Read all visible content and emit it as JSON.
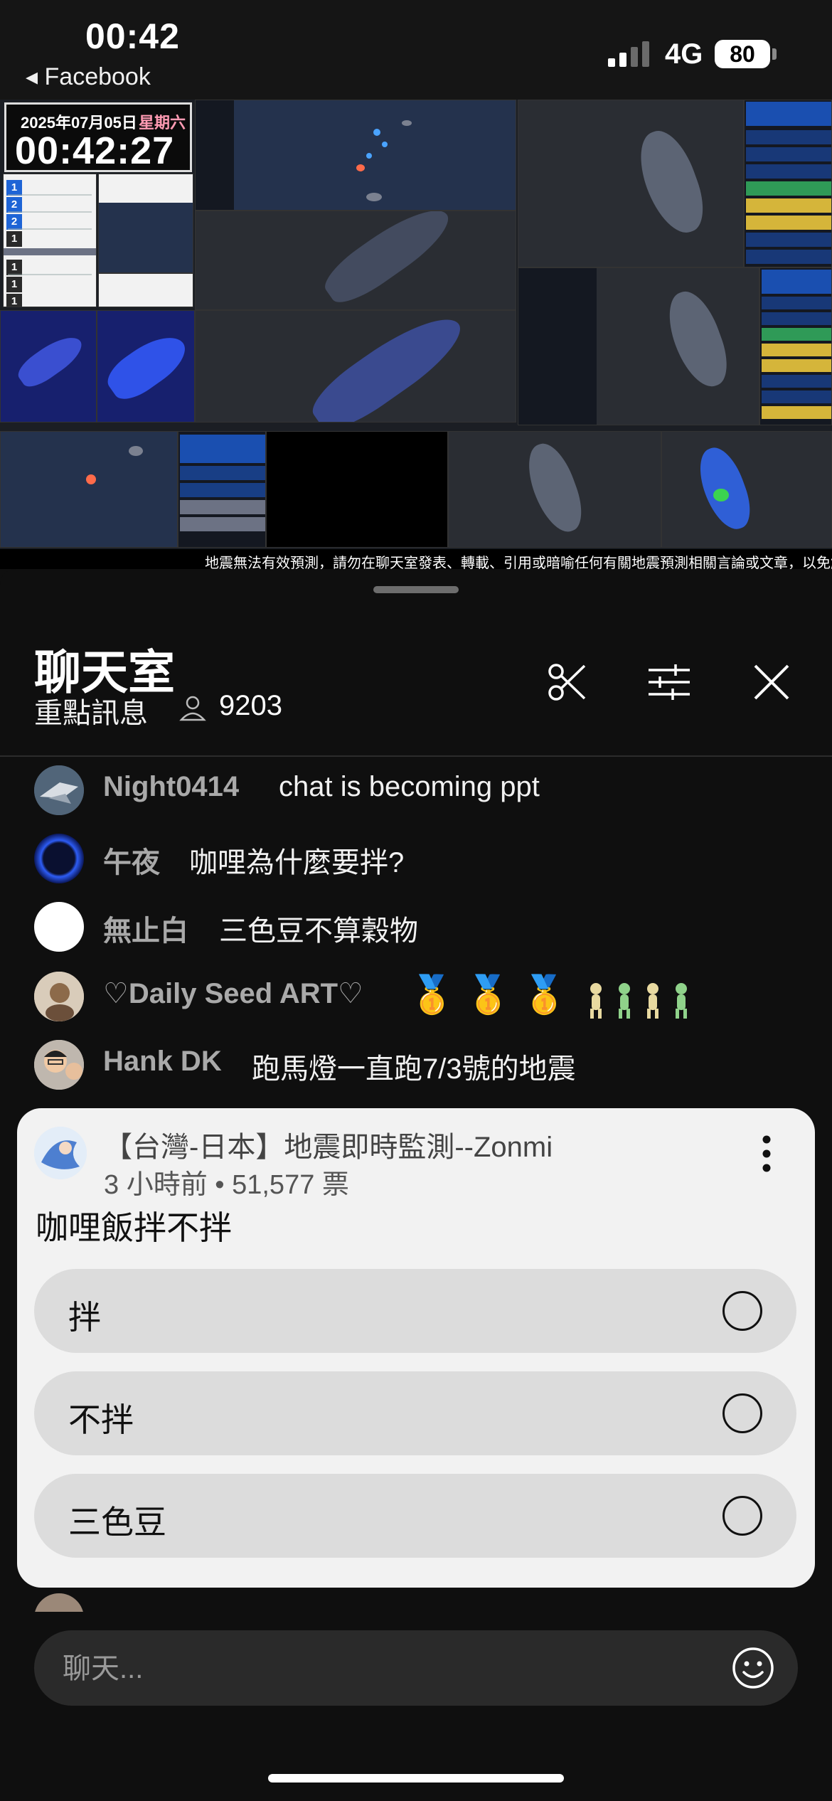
{
  "status_bar": {
    "time": "00:42",
    "back_app": "◂ Facebook",
    "network": "4G",
    "battery": "80"
  },
  "video": {
    "date": "2025年07月05日",
    "weekday": "星期六",
    "clock": "00:42:27",
    "ticker": "地震無法有效預測，請勿在聊天室發表、轉載、引用或暗喻任何有關地震預測相關言論或文章，以免觸犯氣象法"
  },
  "chat_header": {
    "title": "聊天室",
    "subtitle": "重點訊息",
    "viewer_count": "9203",
    "icons": [
      "scissors-icon",
      "sliders-icon",
      "close-icon"
    ]
  },
  "messages": [
    {
      "author": "Night0414",
      "text": "chat is becoming ppt"
    },
    {
      "author": "午夜",
      "text": "咖哩為什麼要拌?"
    },
    {
      "author": "無止白",
      "text": "三色豆不算穀物"
    },
    {
      "author": "♡Daily Seed ART♡",
      "text": "🥇 🥇 🥇 "
    },
    {
      "author": "Hank DK",
      "text": "跑馬燈一直跑7/3號的地震"
    }
  ],
  "poll": {
    "channel": "【台灣-日本】地震即時監測--Zonmi",
    "meta": "3 小時前 • 51,577 票",
    "question": "咖哩飯拌不拌",
    "options": [
      "拌",
      "不拌",
      "三色豆"
    ]
  },
  "input": {
    "placeholder": "聊天..."
  },
  "colors": {
    "background": "#0f0f0f",
    "poll_card": "#f2f2f2",
    "option_pill": "#dcdcdc",
    "author_gray": "#a9a9a9",
    "map_blue": "#1e64d6"
  }
}
